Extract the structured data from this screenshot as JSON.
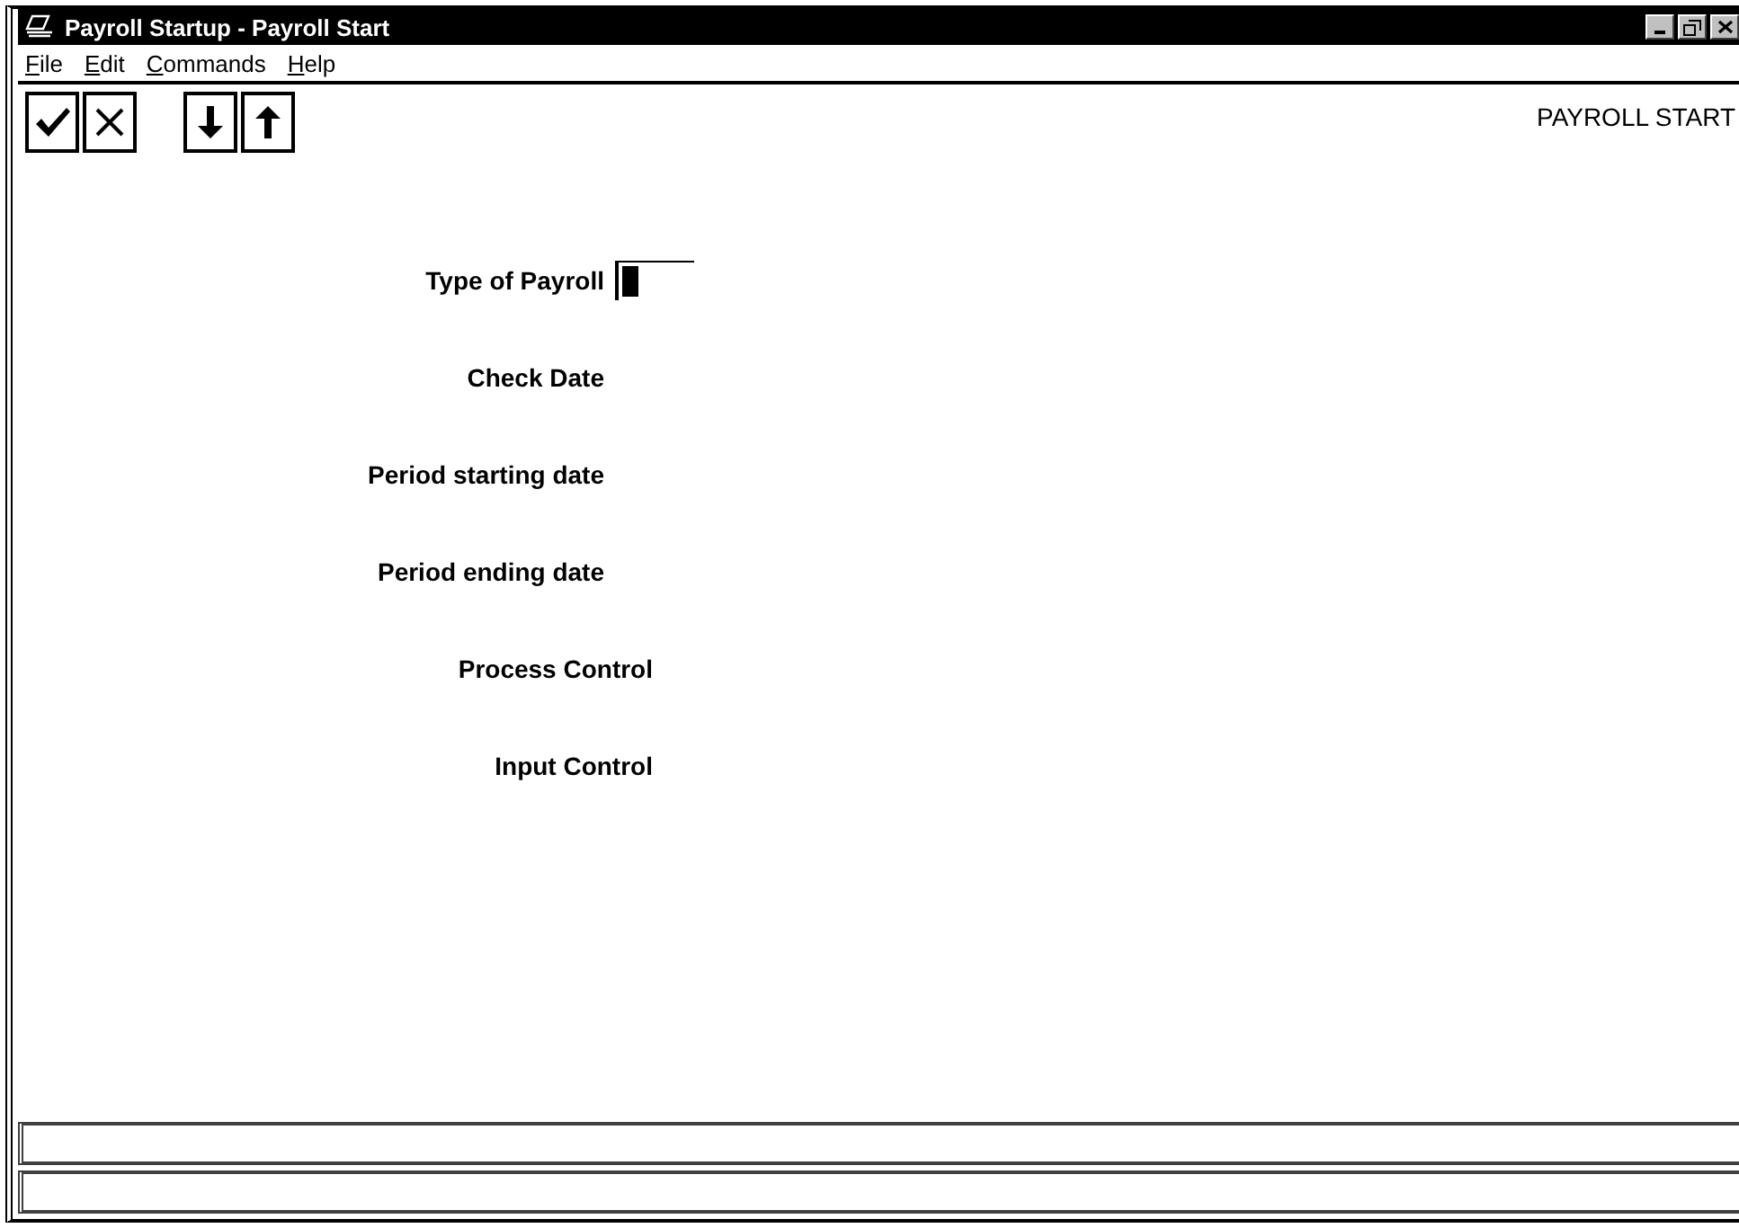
{
  "window": {
    "title": "Payroll Startup - Payroll Start"
  },
  "menu": [
    "File",
    "Edit",
    "Commands",
    "Help"
  ],
  "toolbar": [
    [
      {
        "kind": "check"
      },
      {
        "kind": "cross"
      }
    ],
    [
      {
        "kind": "down"
      },
      {
        "kind": "up"
      }
    ]
  ],
  "screen_title": "PAYROLL START",
  "fields": [
    {
      "label": "Type of Payroll",
      "kind": "entry",
      "input": {
        "focused": true
      }
    },
    {
      "label": "Check Date",
      "kind": "entry"
    },
    {
      "label": "Period starting date",
      "kind": "entry"
    },
    {
      "label": "Period ending date",
      "kind": "entry"
    },
    {
      "label": "Process Control",
      "kind": "section"
    },
    {
      "label": "Input Control",
      "kind": "section"
    }
  ]
}
